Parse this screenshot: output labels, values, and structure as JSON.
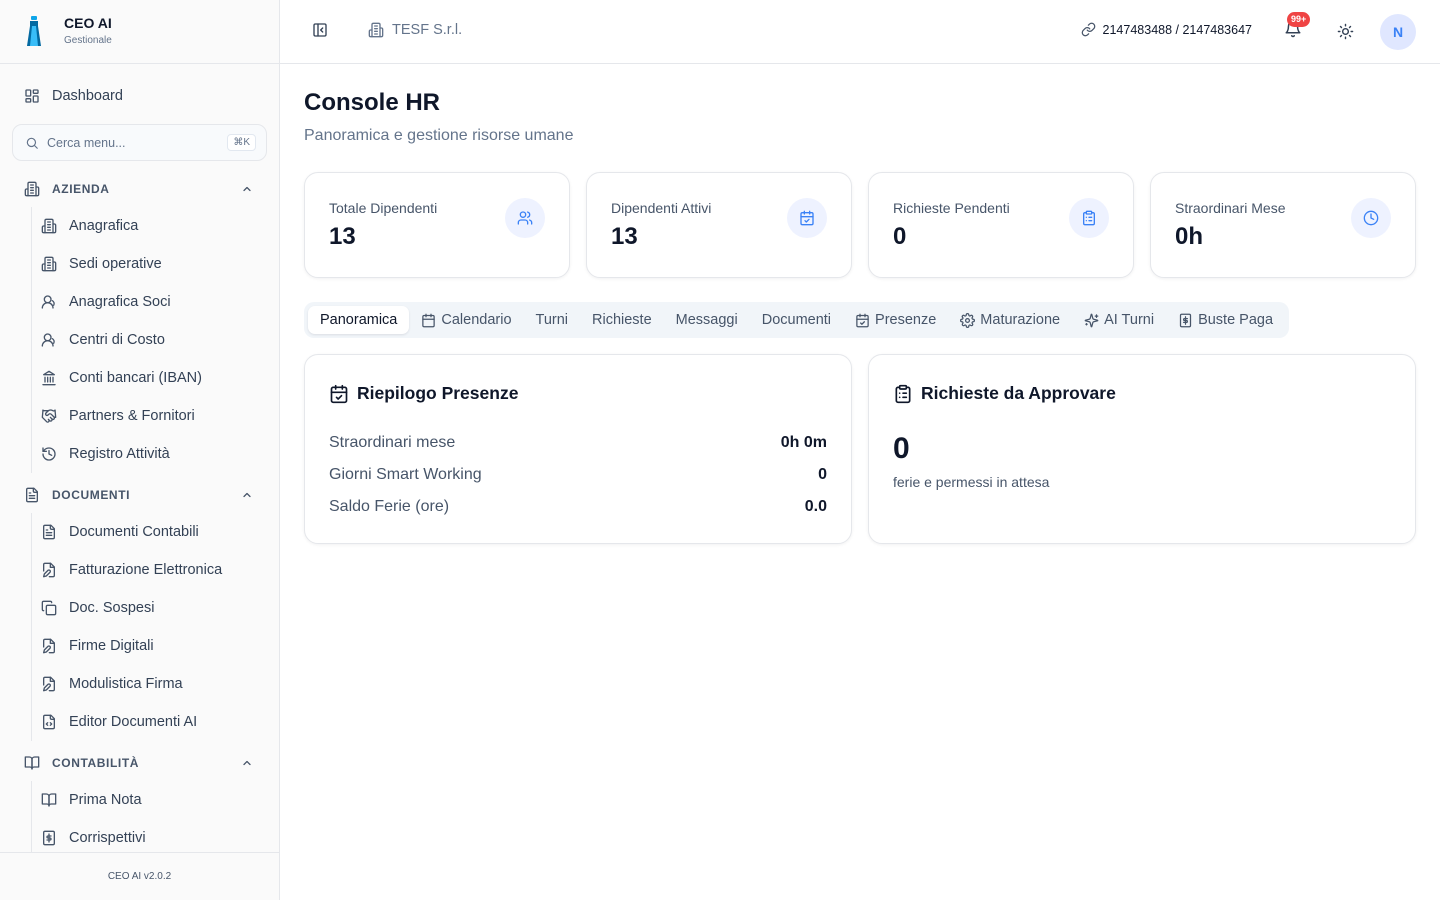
{
  "app": {
    "title": "CEO AI",
    "subtitle": "Gestionale",
    "version": "CEO AI v2.0.2"
  },
  "sidebar": {
    "dashboard": {
      "label": "Dashboard",
      "icon": "dashboard-grid-icon"
    },
    "search": {
      "placeholder": "Cerca menu...",
      "shortcut": "⌘K"
    },
    "sections": [
      {
        "label": "AZIENDA",
        "icon": "building-icon",
        "expanded": true,
        "items": [
          {
            "label": "Anagrafica",
            "icon": "building-icon"
          },
          {
            "label": "Sedi operative",
            "icon": "building-icon"
          },
          {
            "label": "Anagrafica Soci",
            "icon": "user-icon"
          },
          {
            "label": "Centri di Costo",
            "icon": "user-icon"
          },
          {
            "label": "Conti bancari (IBAN)",
            "icon": "bank-icon"
          },
          {
            "label": "Partners & Fornitori",
            "icon": "handshake-icon"
          },
          {
            "label": "Registro Attività",
            "icon": "history-icon"
          }
        ]
      },
      {
        "label": "DOCUMENTI",
        "icon": "file-text-icon",
        "expanded": true,
        "items": [
          {
            "label": "Documenti Contabili",
            "icon": "file-text-icon"
          },
          {
            "label": "Fatturazione Elettronica",
            "icon": "file-edit-icon"
          },
          {
            "label": "Doc. Sospesi",
            "icon": "copy-icon"
          },
          {
            "label": "Firme Digitali",
            "icon": "file-signature-icon"
          },
          {
            "label": "Modulistica Firma",
            "icon": "file-signature-icon"
          },
          {
            "label": "Editor Documenti AI",
            "icon": "file-code-icon"
          }
        ]
      },
      {
        "label": "CONTABILITÀ",
        "icon": "book-icon",
        "expanded": true,
        "items": [
          {
            "label": "Prima Nota",
            "icon": "book-icon"
          },
          {
            "label": "Corrispettivi",
            "icon": "receipt-icon"
          }
        ]
      }
    ]
  },
  "header": {
    "company": "TESF S.r.l.",
    "ids": "2147483488 / 2147483647",
    "notifications_badge": "99+",
    "avatar_initial": "N"
  },
  "main": {
    "title": "Console HR",
    "subtitle": "Panoramica e gestione risorse umane",
    "stats": [
      {
        "label": "Totale Dipendenti",
        "value": "13",
        "icon": "users-icon"
      },
      {
        "label": "Dipendenti Attivi",
        "value": "13",
        "icon": "calendar-check-icon"
      },
      {
        "label": "Richieste Pendenti",
        "value": "0",
        "icon": "clipboard-icon"
      },
      {
        "label": "Straordinari Mese",
        "value": "0h",
        "icon": "clock-icon"
      }
    ],
    "tabs": [
      {
        "label": "Panoramica",
        "icon": ""
      },
      {
        "label": "Calendario",
        "icon": "calendar-icon"
      },
      {
        "label": "Turni",
        "icon": ""
      },
      {
        "label": "Richieste",
        "icon": ""
      },
      {
        "label": "Messaggi",
        "icon": ""
      },
      {
        "label": "Documenti",
        "icon": ""
      },
      {
        "label": "Presenze",
        "icon": "calendar-check-icon"
      },
      {
        "label": "Maturazione",
        "icon": "gear-icon"
      },
      {
        "label": "AI Turni",
        "icon": "sparkles-icon"
      },
      {
        "label": "Buste Paga",
        "icon": "receipt-icon"
      }
    ],
    "active_tab": "Panoramica",
    "presenze": {
      "title": "Riepilogo Presenze",
      "rows": [
        {
          "label": "Straordinari mese",
          "value": "0h 0m"
        },
        {
          "label": "Giorni Smart Working",
          "value": "0"
        },
        {
          "label": "Saldo Ferie (ore)",
          "value": "0.0"
        }
      ]
    },
    "approvals": {
      "title": "Richieste da Approvare",
      "count": "0",
      "note": "ferie e permessi in attesa"
    }
  },
  "colors": {
    "accent": "#3b82f6",
    "accent_bg": "#eef2ff",
    "badge": "#ef4444",
    "border": "#e5e7eb"
  }
}
